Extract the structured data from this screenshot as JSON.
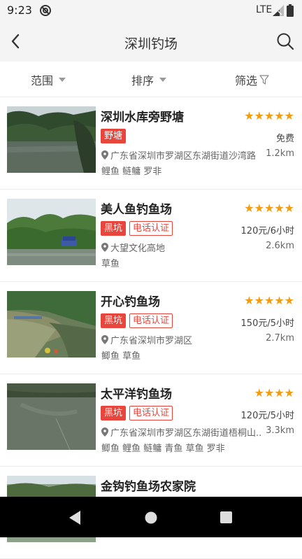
{
  "status_bar": {
    "time": "9:23",
    "network": "LTE",
    "dnd_icon": "dnd-icon",
    "signal_icon": "signal-icon",
    "battery_icon": "battery-icon"
  },
  "header": {
    "title": "深圳钓场",
    "back_icon": "chevron-left-icon",
    "search_icon": "search-icon"
  },
  "filters": {
    "range": "范围",
    "sort": "排序",
    "filter": "筛选"
  },
  "colors": {
    "accent": "#e8453c",
    "star": "#f39c12"
  },
  "spots": [
    {
      "name": "深圳水库旁野塘",
      "rating": 5,
      "stars": "★★★★★",
      "type_tag": "野塘",
      "verify_tag": "",
      "price": "免费",
      "address": "广东省深圳市罗湖区东湖街道沙湾路",
      "distance": "1.2km",
      "fish": "鲤鱼 鲢鳙 罗非"
    },
    {
      "name": "美人鱼钓鱼场",
      "rating": 5,
      "stars": "★★★★★",
      "type_tag": "黑坑",
      "verify_tag": "电话认证",
      "price": "120元/6小时",
      "address": "大望文化高地",
      "distance": "2.6km",
      "fish": "草鱼"
    },
    {
      "name": "开心钓鱼场",
      "rating": 5,
      "stars": "★★★★★",
      "type_tag": "黑坑",
      "verify_tag": "电话认证",
      "price": "150元/5小时",
      "address": "广东省深圳市罗湖区",
      "distance": "2.7km",
      "fish": "鲫鱼 草鱼"
    },
    {
      "name": "太平洋钓鱼场",
      "rating": 4,
      "stars": "★★★★",
      "type_tag": "黑坑",
      "verify_tag": "电话认证",
      "price": "120元/5小时",
      "address": "广东省深圳市罗湖区东湖街道梧桐山...",
      "distance": "3.3km",
      "fish": "鲫鱼 鲤鱼 鲢鳙 青鱼 草鱼 罗非"
    },
    {
      "name": "金钩钓鱼场农家院",
      "rating": 0,
      "stars": "",
      "type_tag": "",
      "verify_tag": "",
      "price": "",
      "address": "",
      "distance": "",
      "fish": ""
    }
  ],
  "nav": {
    "back_icon": "triangle-back-icon",
    "home_icon": "circle-home-icon",
    "recent_icon": "square-recent-icon"
  }
}
